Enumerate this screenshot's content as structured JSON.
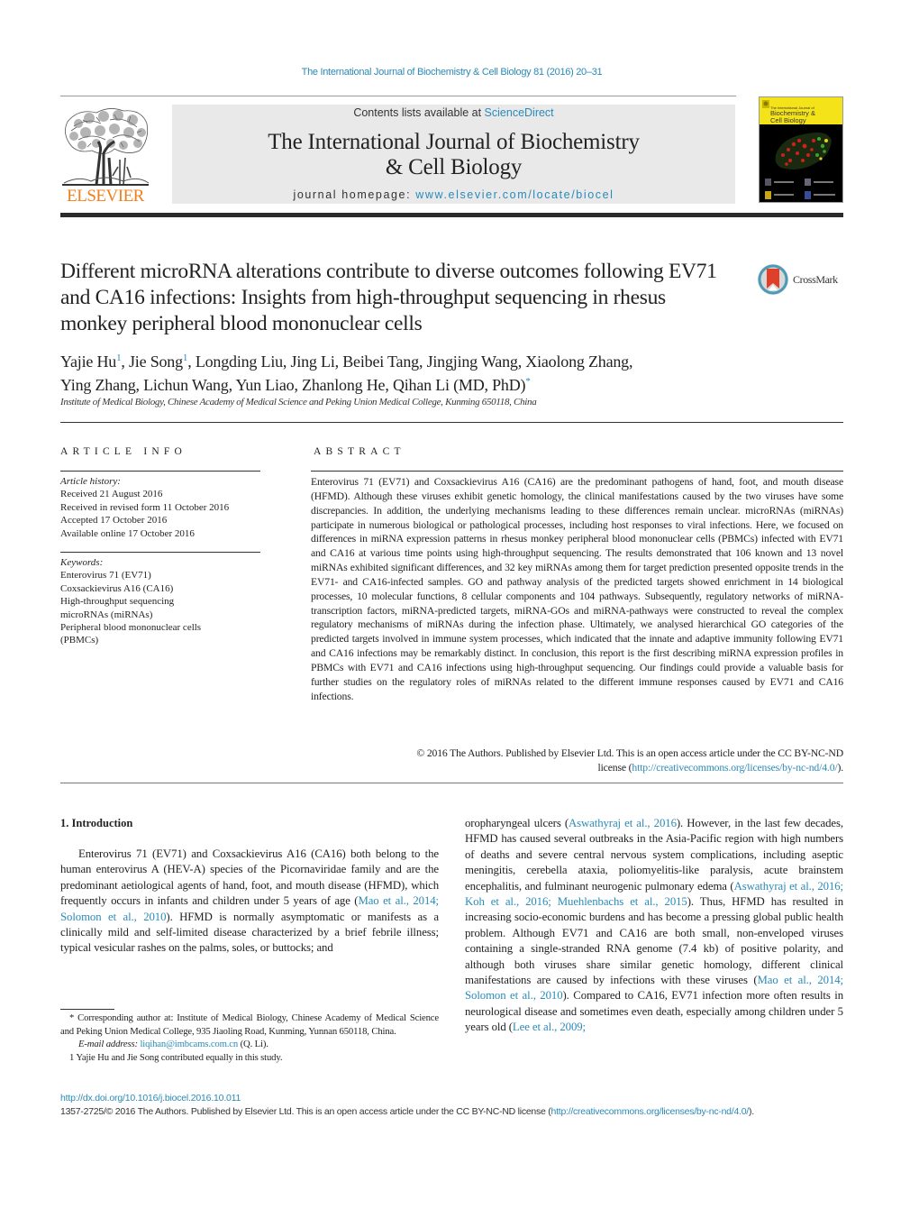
{
  "running_head": "The International Journal of Biochemistry & Cell Biology 81 (2016) 20–31",
  "masthead": {
    "publisher_logo": "ELSEVIER",
    "contents_prefix": "Contents lists available at ",
    "contents_link": "ScienceDirect",
    "journal_title_line1": "The International Journal of Biochemistry",
    "journal_title_line2": "& Cell Biology",
    "homepage_prefix": "journal homepage: ",
    "homepage_link": "www.elsevier.com/locate/biocel",
    "cover_title_line1": "The International Journal of",
    "cover_title_line2": "Biochemistry &",
    "cover_title_line3": "Cell Biology"
  },
  "article": {
    "title": "Different microRNA alterations contribute to diverse outcomes following EV71 and CA16 infections: Insights from high-throughput sequencing in rhesus monkey peripheral blood mononuclear cells",
    "crossmark_label": "CrossMark",
    "authors": [
      {
        "name": "Yajie Hu",
        "sup": "1",
        "sep": ", "
      },
      {
        "name": "Jie Song",
        "sup": "1",
        "sep": ", "
      },
      {
        "name": "Longding Liu",
        "sup": "",
        "sep": ", "
      },
      {
        "name": "Jing Li",
        "sup": "",
        "sep": ", "
      },
      {
        "name": "Beibei Tang",
        "sup": "",
        "sep": ", "
      },
      {
        "name": "Jingjing Wang",
        "sup": "",
        "sep": ", "
      },
      {
        "name": "Xiaolong Zhang",
        "sup": "",
        "sep": ", "
      },
      {
        "name": "Ying Zhang",
        "sup": "",
        "sep": ", "
      },
      {
        "name": "Lichun Wang",
        "sup": "",
        "sep": ", "
      },
      {
        "name": "Yun Liao",
        "sup": "",
        "sep": ", "
      },
      {
        "name": "Zhanlong He",
        "sup": "",
        "sep": ", "
      },
      {
        "name": "Qihan Li (MD, PhD)",
        "sup": "*",
        "sep": ""
      }
    ],
    "affiliation": "Institute of Medical Biology, Chinese Academy of Medical Science and Peking Union Medical College, Kunming 650118, China"
  },
  "article_info": {
    "heading": "ARTICLE INFO",
    "history_title": "Article history:",
    "history": [
      "Received 21 August 2016",
      "Received in revised form 11 October 2016",
      "Accepted 17 October 2016",
      "Available online 17 October 2016"
    ],
    "keywords_title": "Keywords:",
    "keywords": [
      "Enterovirus 71 (EV71)",
      "Coxsackievirus A16 (CA16)",
      "High-throughput sequencing",
      "microRNAs (miRNAs)",
      "Peripheral blood mononuclear cells (PBMCs)"
    ]
  },
  "abstract": {
    "heading": "ABSTRACT",
    "text": "Enterovirus 71 (EV71) and Coxsackievirus A16 (CA16) are the predominant pathogens of hand, foot, and mouth disease (HFMD). Although these viruses exhibit genetic homology, the clinical manifestations caused by the two viruses have some discrepancies. In addition, the underlying mechanisms leading to these differences remain unclear. microRNAs (miRNAs) participate in numerous biological or pathological processes, including host responses to viral infections. Here, we focused on differences in miRNA expression patterns in rhesus monkey peripheral blood mononuclear cells (PBMCs) infected with EV71 and CA16 at various time points using high-throughput sequencing. The results demonstrated that 106 known and 13 novel miRNAs exhibited significant differences, and 32 key miRNAs among them for target prediction presented opposite trends in the EV71- and CA16-infected samples. GO and pathway analysis of the predicted targets showed enrichment in 14 biological processes, 10 molecular functions, 8 cellular components and 104 pathways. Subsequently, regulatory networks of miRNA-transcription factors, miRNA-predicted targets, miRNA-GOs and miRNA-pathways were constructed to reveal the complex regulatory mechanisms of miRNAs during the infection phase. Ultimately, we analysed hierarchical GO categories of the predicted targets involved in immune system processes, which indicated that the innate and adaptive immunity following EV71 and CA16 infections may be remarkably distinct. In conclusion, this report is the first describing miRNA expression profiles in PBMCs with EV71 and CA16 infections using high-throughput sequencing. Our findings could provide a valuable basis for further studies on the regulatory roles of miRNAs related to the different immune responses caused by EV71 and CA16 infections.",
    "copyright_line1": "© 2016 The Authors. Published by Elsevier Ltd. This is an open access article under the CC BY-NC-ND",
    "copyright_prefix2": "license (",
    "copyright_link": "http://creativecommons.org/licenses/by-nc-nd/4.0/",
    "copyright_suffix2": ")."
  },
  "body": {
    "intro_heading": "1.  Introduction",
    "left": {
      "p1_a": "Enterovirus 71 (EV71) and Coxsackievirus A16 (CA16) both belong to the human enterovirus A (HEV-A) species of the Picornaviridae family and are the predominant aetiological agents of hand, foot, and mouth disease (HFMD), which frequently occurs in infants and children under 5 years of age (",
      "cite1": "Mao et al., 2014; Solomon et al., 2010",
      "p1_b": "). HFMD is normally asymptomatic or manifests as a clinically mild and self-limited disease characterized by a brief febrile illness; typical vesicular rashes on the palms, soles, or buttocks; and"
    },
    "right": {
      "t1": "oropharyngeal ulcers (",
      "cite1": "Aswathyraj et al., 2016",
      "t2": "). However, in the last few decades, HFMD has caused several outbreaks in the Asia-Pacific region with high numbers of deaths and severe central nervous system complications, including aseptic meningitis, cerebella ataxia, poliomyelitis-like paralysis, acute brainstem encephalitis, and fulminant neurogenic pulmonary edema (",
      "cite2": "Aswathyraj et al., 2016; Koh et al., 2016; Muehlenbachs et al., 2015",
      "t3": "). Thus, HFMD has resulted in increasing socio-economic burdens and has become a pressing global public health problem. Although EV71 and CA16 are both small, non-enveloped viruses containing a single-stranded RNA genome (7.4 kb) of positive polarity, and although both viruses share similar genetic homology, different clinical manifestations are caused by infections with these viruses (",
      "cite3": "Mao et al., 2014; Solomon et al., 2010",
      "t4": "). Compared to CA16, EV71 infection more often results in neurological disease and sometimes even death, especially among children under 5 years old (",
      "cite4": "Lee et al., 2009;"
    }
  },
  "footnotes": {
    "corresponding": "* Corresponding author at: Institute of Medical Biology, Chinese Academy of Medical Science and Peking Union Medical College, 935 Jiaoling Road, Kunming, Yunnan 650118, China.",
    "email_label": "E-mail address: ",
    "email": "liqihan@imbcams.com.cn",
    "email_suffix": " (Q. Li).",
    "equal_contrib": "1  Yajie Hu and Jie Song contributed equally in this study."
  },
  "page_footer": {
    "doi": "http://dx.doi.org/10.1016/j.biocel.2016.10.011",
    "issn_text": "1357-2725/© 2016 The Authors. Published by Elsevier Ltd. This is an open access article under the CC BY-NC-ND license (",
    "license_link": "http://creativecommons.org/licenses/by-nc-nd/4.0/",
    "issn_suffix": ")."
  },
  "colors": {
    "link": "#2a8ab8",
    "elsevier_orange": "#f07f1b",
    "masthead_bg": "#e9e9ea",
    "cover_yellow": "#f5e31a"
  }
}
